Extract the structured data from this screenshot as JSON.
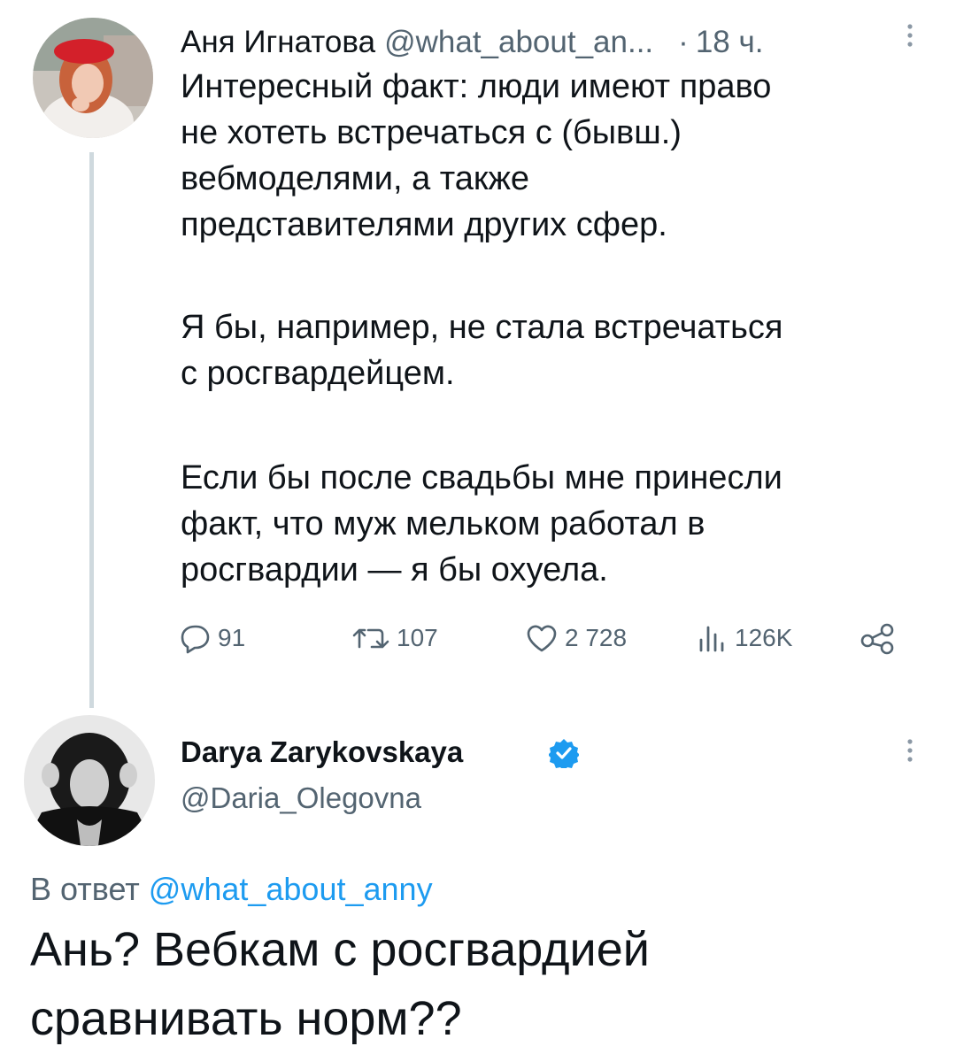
{
  "tweet1": {
    "author_name": "Аня Игнатова",
    "handle": "@what_about_an...",
    "separator": "·",
    "time": "18 ч.",
    "paragraph1": [
      "Интересный факт: люди имеют право",
      "не хотеть встречаться с (бывш.)",
      "вебмоделями, а также",
      "представителями других сфер."
    ],
    "paragraph2": [
      "Я бы, например, не стала встречаться",
      "с росгвардейцем."
    ],
    "paragraph3": [
      "Если бы после свадьбы мне принесли",
      "факт, что муж мельком работал в",
      "росгвардии — я бы охуела."
    ],
    "actions": {
      "replies": "91",
      "retweets": "107",
      "likes": "2 728",
      "views": "126K"
    }
  },
  "tweet2": {
    "author_name": "Darya Zarykovskaya",
    "handle": "@Daria_Olegovna",
    "reply_prefix": "В ответ",
    "reply_to": "@what_about_anny",
    "text": [
      "Ань? Вебкам с росгвардией",
      "сравнивать норм??"
    ]
  },
  "colors": {
    "text": "#0f1419",
    "secondary": "#536471",
    "link": "#1d9bf0",
    "thread_line": "#cfd9de",
    "verified": "#1d9bf0"
  },
  "icons": [
    "reply-icon",
    "retweet-icon",
    "like-icon",
    "views-icon",
    "share-icon",
    "more-icon",
    "verified-badge-icon"
  ]
}
